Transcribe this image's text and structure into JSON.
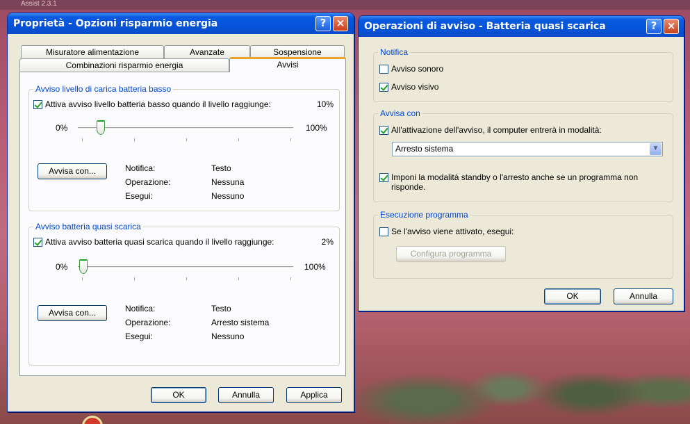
{
  "desktop": {
    "top_text": "Assist    2.3.1"
  },
  "win1": {
    "title": "Proprietà - Opzioni risparmio energia",
    "tabs_row1": [
      "Misuratore alimentazione",
      "Avanzate",
      "Sospensione"
    ],
    "tabs_row2": [
      "Combinazioni risparmio energia",
      "Avvisi"
    ],
    "low": {
      "group_title": "Avviso livello di carica batteria basso",
      "check_label": "Attiva avviso livello batteria basso quando il livello raggiunge:",
      "checked": true,
      "level": "10%",
      "level_value": 10,
      "min": "0%",
      "max": "100%",
      "button": "Avvisa con...",
      "rows": [
        {
          "k": "Notifica:",
          "v": "Testo"
        },
        {
          "k": "Operazione:",
          "v": "Nessuna"
        },
        {
          "k": "Esegui:",
          "v": "Nessuno"
        }
      ]
    },
    "critical": {
      "group_title": "Avviso batteria quasi scarica",
      "check_label": "Attiva avviso batteria quasi scarica quando il livello raggiunge:",
      "checked": true,
      "level": "2%",
      "level_value": 2,
      "min": "0%",
      "max": "100%",
      "button": "Avvisa con...",
      "rows": [
        {
          "k": "Notifica:",
          "v": "Testo"
        },
        {
          "k": "Operazione:",
          "v": "Arresto sistema"
        },
        {
          "k": "Esegui:",
          "v": "Nessuno"
        }
      ]
    },
    "buttons": {
      "ok": "OK",
      "cancel": "Annulla",
      "apply": "Applica"
    }
  },
  "win2": {
    "title": "Operazioni di avviso - Batteria quasi scarica",
    "notifica": {
      "group_title": "Notifica",
      "sound": "Avviso sonoro",
      "sound_checked": false,
      "visual": "Avviso visivo",
      "visual_checked": true
    },
    "avvisa": {
      "group_title": "Avvisa con",
      "check_label": "All'attivazione dell'avviso, il computer entrerà in modalità:",
      "checked": true,
      "select_value": "Arresto sistema",
      "force_label_1": "Imponi la modalità standby o l'arresto anche se un programma non",
      "force_label_2": "risponde.",
      "force_checked": true
    },
    "prog": {
      "group_title": "Esecuzione programma",
      "check_label": "Se l'avviso viene attivato, esegui:",
      "checked": false,
      "config_button": "Configura programma"
    },
    "buttons": {
      "ok": "OK",
      "cancel": "Annulla"
    }
  },
  "icons": {
    "help": "?",
    "close": "×",
    "dropdown": "▼"
  }
}
